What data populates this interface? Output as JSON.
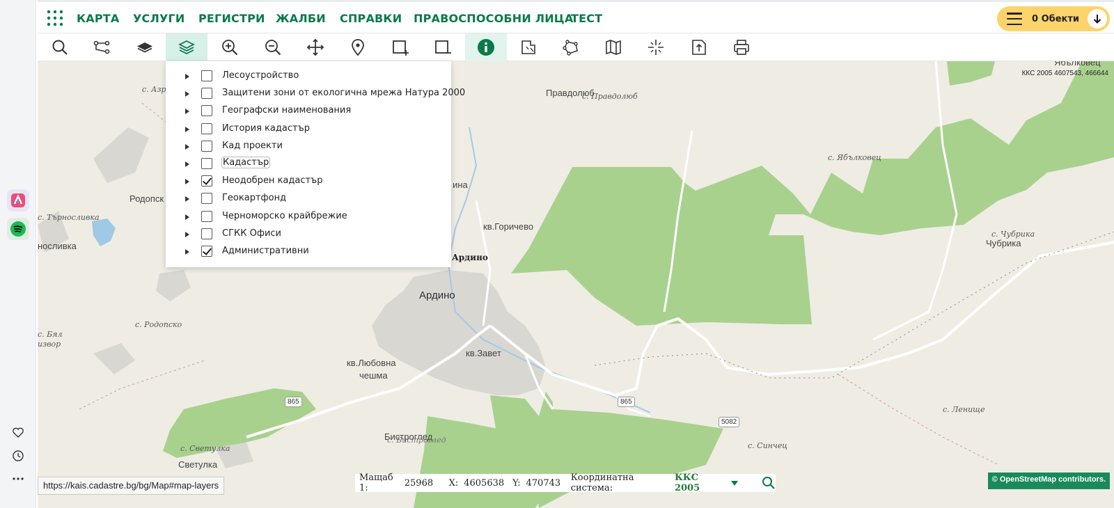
{
  "browser": {
    "status_url": "https://kais.cadastre.bg/bg/Map#map-layers",
    "rail_apps": [
      "arc-app-icon",
      "spotify-icon"
    ],
    "rail_actions": [
      "heart-icon",
      "history-icon",
      "more-icon"
    ]
  },
  "nav": {
    "items": [
      "КАРТА",
      "УСЛУГИ",
      "РЕГИСТРИ",
      "ЖАЛБИ",
      "СПРАВКИ",
      "ПРАВОСПОСОБНИ ЛИЦА",
      "ТЕСТ"
    ],
    "objects_label": "0 Обекти"
  },
  "toolbar": {
    "tools": [
      "search-icon",
      "route-icon",
      "basemap-icon",
      "layers-icon",
      "zoom-in-icon",
      "zoom-out-icon",
      "pan-icon",
      "marker-icon",
      "select-box-add-icon",
      "select-box-remove-icon",
      "info-icon",
      "measure-icon",
      "polygon-icon",
      "map-icon",
      "crosshair-icon",
      "export-icon",
      "print-icon"
    ],
    "active": "layers-icon"
  },
  "layers": {
    "items": [
      {
        "label": "Лесоустройство",
        "checked": false
      },
      {
        "label": "Защитени зони от екологична мрежа Натура 2000",
        "checked": false
      },
      {
        "label": "Географски наименования",
        "checked": false
      },
      {
        "label": "История кадастър",
        "checked": false
      },
      {
        "label": "Кад проекти",
        "checked": false
      },
      {
        "label": "Кадастър",
        "checked": false
      },
      {
        "label": "Неодобрен кадастър",
        "checked": true
      },
      {
        "label": "Геокартфонд",
        "checked": false
      },
      {
        "label": "Черноморско крайбрежие",
        "checked": false
      },
      {
        "label": "СГКК Офиси",
        "checked": false
      },
      {
        "label": "Административни",
        "checked": true
      }
    ]
  },
  "map": {
    "coords_readout": "ККС 2005 4607543, 466644",
    "places": {
      "azra": "с. Азря",
      "rodopsko_top": "Родопск",
      "trnoslivka_v": "с. Търносливка",
      "trnoslivka": "носливка",
      "pravdolyub": "Правдолюб",
      "pravdolyub_v": "с. Правдолюб",
      "yablkovets_v": "с. Ябълковец",
      "yablkovets": "Ябълковец",
      "gorichevo": "кв.Горичево",
      "ardino_label": "Ардино",
      "ardino": "Ардино",
      "rodopsko_v": "с. Родопско",
      "byal_1": "с. Бял",
      "byal_2": "извор",
      "lyubovna": "кв.Любовна",
      "cheshma": "чешма",
      "zavet": "кв.Завет",
      "chubrika_v": "с. Чубрика",
      "chubrika": "Чубрика",
      "lenishte": "с. Ленище",
      "sinchets": "с. Синчец",
      "bistrogled": "Бистроглед",
      "bistrogled_v": "с. Бистроглед",
      "svetulka_v": "с. Светулка",
      "svetulka": "Светулка",
      "ina": "ина"
    },
    "roads": {
      "r865a": "865",
      "r865b": "865",
      "r5082": "5082"
    },
    "colors": {
      "land": "#efece4",
      "forest": "#a9d18e",
      "urban": "#d9d7d2",
      "water": "#9fc9e4",
      "accent": "#0a7a4a"
    }
  },
  "status": {
    "scale_label": "Мащаб 1:",
    "scale_value": "25968",
    "x_label": "X:",
    "x_value": "4605638",
    "y_label": "Y:",
    "y_value": "470743",
    "crs_label": "Координатна система:",
    "crs_value": "ККС 2005"
  },
  "attribution": "© OpenStreetMap contributors."
}
